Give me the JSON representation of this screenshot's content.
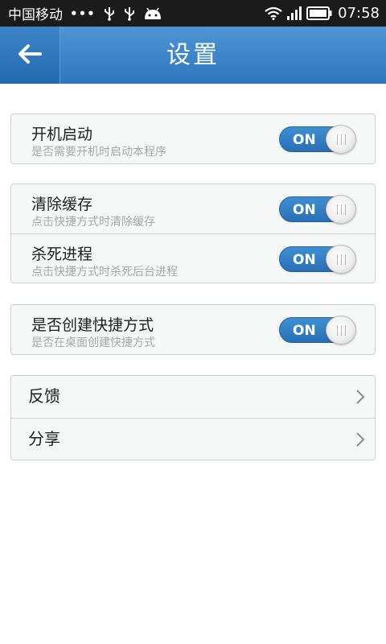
{
  "status_bar": {
    "carrier": "中国移动",
    "dots": "•••",
    "time": "07:58",
    "icons": [
      "usb-icon",
      "usb-icon",
      "android-icon",
      "wifi-icon",
      "signal-icon",
      "battery-icon"
    ]
  },
  "header": {
    "title": "设置",
    "back_icon": "arrow-left-icon",
    "color": "#3b82c9"
  },
  "settings": {
    "startup": {
      "title": "开机启动",
      "subtitle": "是否需要开机时启动本程序",
      "toggle": "ON"
    },
    "clear_cache": {
      "title": "清除缓存",
      "subtitle": "点击快捷方式时清除缓存",
      "toggle": "ON"
    },
    "kill_process": {
      "title": "杀死进程",
      "subtitle": "点击快捷方式时杀死后台进程",
      "toggle": "ON"
    },
    "create_shortcut": {
      "title": "是否创建快捷方式",
      "subtitle": "是否在桌面创建快捷方式",
      "toggle": "ON"
    },
    "feedback": {
      "label": "反馈",
      "icon": "chevron-right-icon"
    },
    "share": {
      "label": "分享",
      "icon": "chevron-right-icon"
    }
  },
  "colors": {
    "accent": "#2f76bd",
    "toggle_on": "#3785cb"
  }
}
